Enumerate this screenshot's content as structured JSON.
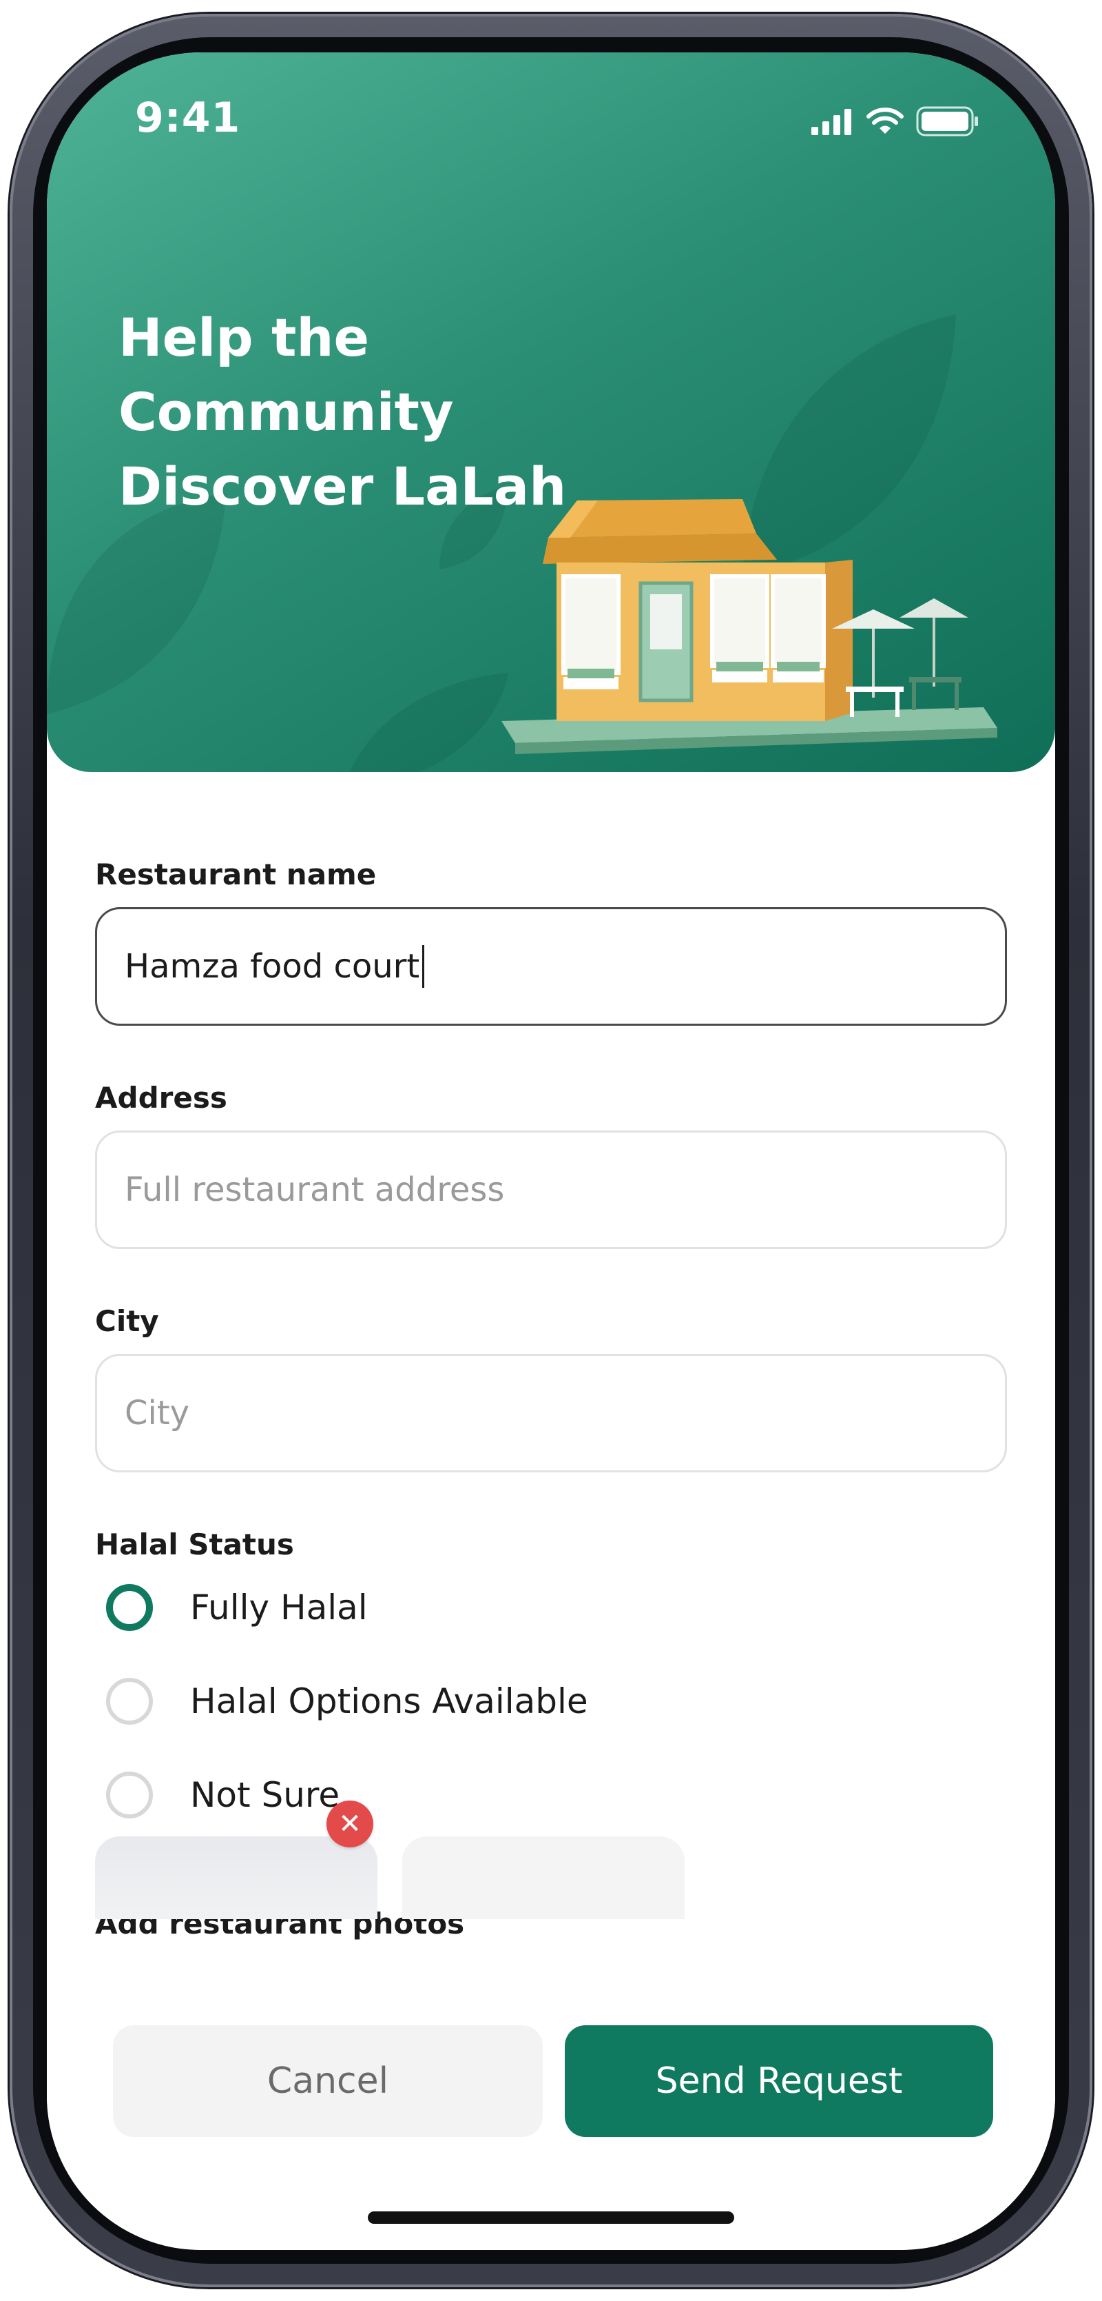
{
  "status_bar": {
    "time": "9:41"
  },
  "hero": {
    "title_line1": "Help the Community",
    "title_line2": "Discover LaLah"
  },
  "form": {
    "restaurant_name": {
      "label": "Restaurant name",
      "value": "Hamza food court"
    },
    "address": {
      "label": "Address",
      "placeholder": "Full restaurant address"
    },
    "city": {
      "label": "City",
      "placeholder": "City"
    },
    "halal_status": {
      "label": "Halal Status",
      "options": [
        "Fully Halal",
        "Halal Options Available",
        "Not Sure"
      ],
      "selected": "Fully Halal"
    },
    "photos": {
      "label": "Add restaurant photos",
      "remove_icon": "close-icon"
    }
  },
  "actions": {
    "cancel_label": "Cancel",
    "send_label": "Send Request"
  },
  "colors": {
    "brand": "#0f7a5f",
    "hero_start": "#4fb397",
    "hero_end": "#0f6e57",
    "danger": "#e34b4b"
  }
}
